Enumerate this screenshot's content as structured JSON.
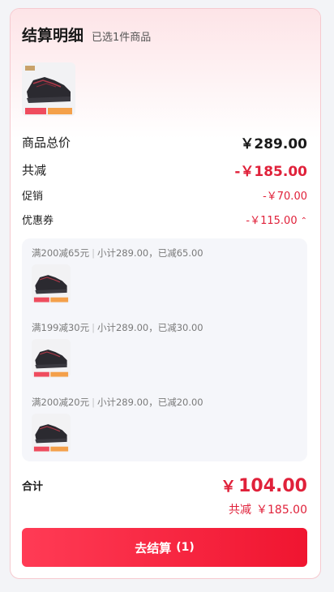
{
  "header": {
    "title": "结算明细",
    "subtitle": "已选1件商品"
  },
  "product": {
    "image_icon": "shoe-thumbnail"
  },
  "summary": {
    "goods_total_label": "商品总价",
    "goods_total_value": "￥289.00",
    "total_reduce_label": "共减",
    "total_reduce_value": "-￥185.00",
    "promo_label": "促销",
    "promo_value": "-￥70.00",
    "coupon_label": "优惠券",
    "coupon_value": "-￥115.00",
    "coupon_toggle_icon": "chevron-up-icon"
  },
  "coupons": [
    {
      "rule": "满200减65元",
      "detail": "小计289.00，已减65.00"
    },
    {
      "rule": "满199减30元",
      "detail": "小计289.00，已减30.00"
    },
    {
      "rule": "满200减20元",
      "detail": "小计289.00，已减20.00"
    }
  ],
  "footer": {
    "sum_label": "合计",
    "currency": "￥",
    "sum_value": "104.00",
    "reduce_label": "共减",
    "reduce_value": "￥185.00",
    "checkout_label": "去结算",
    "checkout_count": "(1)"
  },
  "colors": {
    "accent_red": "#e0213a",
    "button_gradient_start": "#ff3b55",
    "button_gradient_end": "#f01530"
  }
}
